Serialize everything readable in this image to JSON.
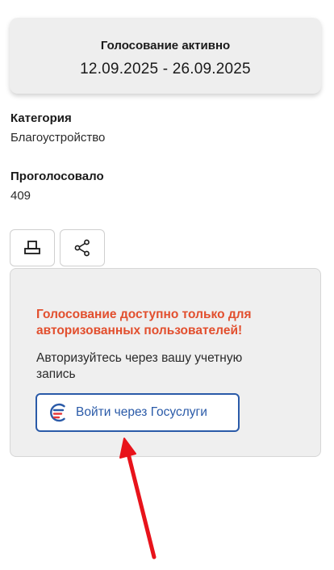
{
  "status": {
    "title": "Голосование активно",
    "dates": "12.09.2025 - 26.09.2025"
  },
  "info": {
    "category_label": "Категория",
    "category_value": "Благоустройство",
    "votes_label": "Проголосовало",
    "votes_value": "409"
  },
  "actions": {
    "print_icon": "print-icon",
    "share_icon": "share-icon"
  },
  "auth": {
    "warning_line1": "Голосование доступно только для",
    "warning_line2": "авторизованных пользователей!",
    "hint_line1": "Авторизуйтесь через вашу учетную",
    "hint_line2": "запись",
    "button_label": "Войти через Госуслуги",
    "button_icon": "gosuslugi-logo-icon"
  },
  "colors": {
    "warning": "#e24f2e",
    "gos_blue": "#2a5aa8",
    "gos_red": "#e5383b",
    "annotation_arrow": "#e8131b"
  }
}
